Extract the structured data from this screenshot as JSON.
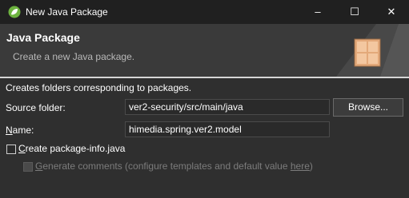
{
  "window": {
    "title": "New Java Package",
    "icon": "spring-leaf-icon",
    "controls": {
      "minimize": "–",
      "maximize": "☐",
      "close": "✕"
    }
  },
  "banner": {
    "title": "Java Package",
    "subtitle": "Create a new Java package.",
    "icon": "package-icon"
  },
  "form": {
    "description": "Creates folders corresponding to packages.",
    "source_folder": {
      "label_mnemonic": "",
      "label_rest": "Source folder:",
      "value": "ver2-security/src/main/java",
      "browse_label": "Browse..."
    },
    "name": {
      "label_mnemonic": "N",
      "label_rest": "ame:",
      "value": "himedia.spring.ver2.model"
    },
    "create_package_info": {
      "label_mnemonic": "C",
      "label_rest": "reate package-info.java",
      "checked": false
    },
    "generate_comments": {
      "label_mnemonic": "G",
      "label_rest": "enerate comments (configure templates and default value ",
      "link_text": "here",
      "label_end": ")",
      "checked": false,
      "enabled": false
    }
  },
  "colors": {
    "background": "#2f2f2f",
    "titlebar": "#202020",
    "banner": "#3a3a3a",
    "separator": "#d6d6d6",
    "disabled_text": "#7c7c7c"
  }
}
